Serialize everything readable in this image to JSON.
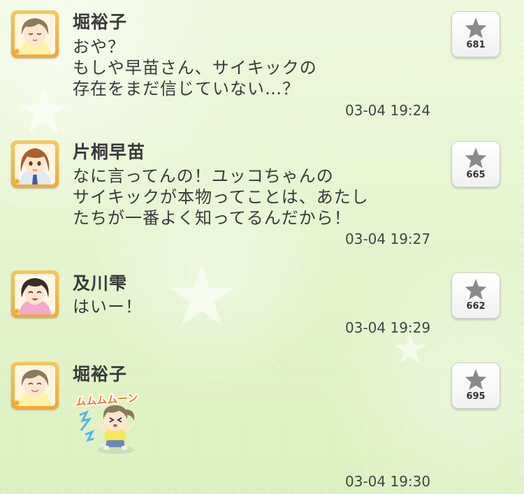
{
  "messages": [
    {
      "name": "堀裕子",
      "text": "おや？\nもしや早苗さん、サイキックの\n存在をまだ信じていない…？",
      "time": "03-04 19:24",
      "likes": "681",
      "avatar_icon": "character-avatar-yuko-icon"
    },
    {
      "name": "片桐早苗",
      "text": "なに言ってんの！ユッコちゃんの\nサイキックが本物ってことは、あたし\nたちが一番よく知ってるんだから！",
      "time": "03-04 19:27",
      "likes": "665",
      "avatar_icon": "character-avatar-sanae-icon"
    },
    {
      "name": "及川雫",
      "text": "はいー！",
      "time": "03-04 19:29",
      "likes": "662",
      "avatar_icon": "character-avatar-shizuku-icon"
    },
    {
      "name": "堀裕子",
      "stamp_text": "ムムムムーン",
      "time": "03-04 19:30",
      "likes": "695",
      "avatar_icon": "character-avatar-yuko-icon"
    }
  ],
  "colors": {
    "avatar_frame": "#f0a93c",
    "star": "#8a8a8a",
    "stamp_text": "#f07a2a",
    "stamp_lightning": "#4fb7ea"
  }
}
